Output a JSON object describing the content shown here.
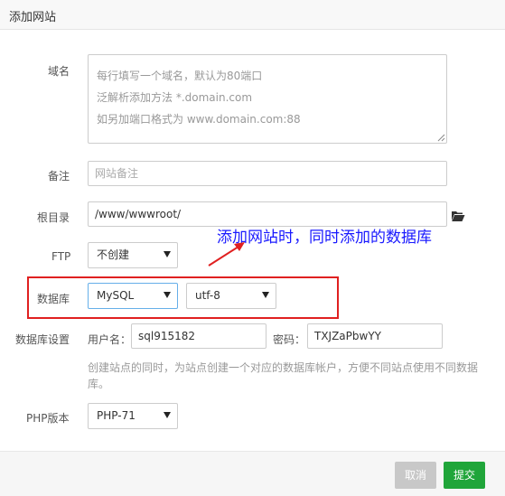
{
  "dialog": {
    "title": "添加网站"
  },
  "form": {
    "domain": {
      "label": "域名",
      "placeholder_lines": [
        "每行填写一个域名，默认为80端口",
        "泛解析添加方法 *.domain.com",
        "如另加端口格式为 www.domain.com:88"
      ]
    },
    "remark": {
      "label": "备注",
      "placeholder": "网站备注"
    },
    "root_dir": {
      "label": "根目录",
      "value": "/www/wwwroot/",
      "icon": "folder-open-icon"
    },
    "ftp": {
      "label": "FTP",
      "selected": "不创建"
    },
    "database": {
      "label": "数据库",
      "type_selected": "MySQL",
      "charset_selected": "utf-8"
    },
    "db_settings": {
      "label": "数据库设置",
      "username_label": "用户名：",
      "username_value": "sql915182",
      "password_label": "密码：",
      "password_value": "TXJZaPbwYY",
      "help": "创建站点的同时，为站点创建一个对应的数据库帐户，方便不同站点使用不同数据库。"
    },
    "php": {
      "label": "PHP版本",
      "selected": "PHP-71"
    }
  },
  "annotation": {
    "text": "添加网站时，同时添加的数据库",
    "color": "#1a1aff",
    "highlight_color": "#e02020"
  },
  "footer": {
    "cancel_label": "取消",
    "submit_label": "提交",
    "submit_color": "#20a53a"
  }
}
